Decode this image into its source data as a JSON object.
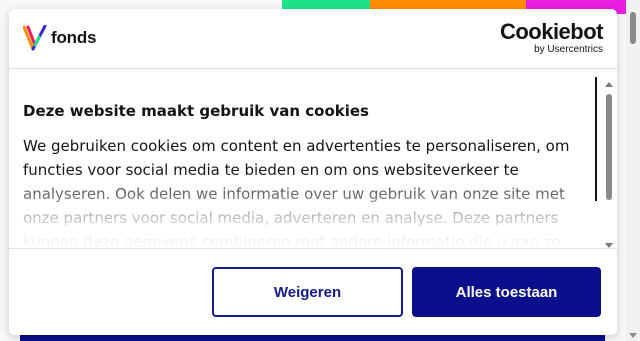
{
  "brand": {
    "name": "fonds"
  },
  "cookiebot": {
    "name": "Cookiebot",
    "byline": "by Usercentrics"
  },
  "consent": {
    "title": "Deze website maakt gebruik van cookies",
    "body": "We gebruiken cookies om content en advertenties te personaliseren, om functies voor social media te bieden en om ons websiteverkeer te analyseren. Ook delen we informatie over uw gebruik van onze site met onze partners voor social media, adverteren en analyse. Deze partners kunnen deze gegevens combineren met andere informatie die u aan ze"
  },
  "buttons": {
    "decline": "Weigeren",
    "accept": "Alles toestaan"
  },
  "colors": {
    "accent": "#0a0f8c",
    "strip_green": "#1de38a",
    "strip_orange": "#ff8c00",
    "strip_magenta": "#e91ee0"
  },
  "icons": {
    "brand": "fonds-v-logo",
    "content_scroll_up": "arrow-up-icon",
    "content_scroll_down": "arrow-down-icon",
    "page_scroll_down": "arrow-down-icon"
  }
}
